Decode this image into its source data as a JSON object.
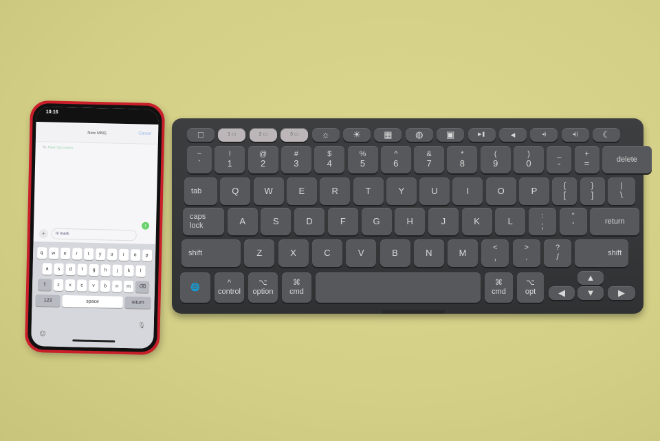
{
  "phone": {
    "status_time": "10:16",
    "nav_title": "New MMS",
    "cancel": "Cancel",
    "to_label": "To:",
    "to_name": "Mark Spoonauer",
    "message": "hi mark",
    "plus_icon": "+",
    "send_icon": "arrow-up",
    "keyboard": {
      "row1": [
        "q",
        "w",
        "e",
        "r",
        "t",
        "y",
        "u",
        "i",
        "o",
        "p"
      ],
      "row2": [
        "a",
        "s",
        "d",
        "f",
        "g",
        "h",
        "j",
        "k",
        "l"
      ],
      "row3": [
        "z",
        "x",
        "c",
        "v",
        "b",
        "n",
        "m"
      ],
      "numbers": "123",
      "space": "space",
      "return": "return"
    }
  },
  "keyboard": {
    "fn_row": [
      "□",
      "1 ▭",
      "2 ▭",
      "3 ▭",
      "☼",
      "☀",
      "▦",
      "◍",
      "▣",
      "▶❚",
      "◂",
      "◂)",
      "◂))",
      "☾"
    ],
    "num_row": [
      [
        "~",
        "`"
      ],
      [
        "!",
        "1"
      ],
      [
        "@",
        "2"
      ],
      [
        "#",
        "3"
      ],
      [
        "$",
        "4"
      ],
      [
        "%",
        "5"
      ],
      [
        "^",
        "6"
      ],
      [
        "&",
        "7"
      ],
      [
        "*",
        "8"
      ],
      [
        "(",
        "9"
      ],
      [
        ")",
        "0"
      ],
      [
        "_",
        "-"
      ],
      [
        "+",
        "="
      ],
      [
        "",
        "delete"
      ]
    ],
    "q_row": [
      [
        "",
        "tab"
      ],
      [
        "",
        "Q"
      ],
      [
        "",
        "W"
      ],
      [
        "",
        "E"
      ],
      [
        "",
        "R"
      ],
      [
        "",
        "T"
      ],
      [
        "",
        "Y"
      ],
      [
        "",
        "U"
      ],
      [
        "",
        "I"
      ],
      [
        "",
        "O"
      ],
      [
        "",
        "P"
      ],
      [
        "{",
        "["
      ],
      [
        "}",
        "]"
      ],
      [
        "|",
        "\\"
      ]
    ],
    "a_row": [
      [
        "caps",
        "lock"
      ],
      [
        "",
        "A"
      ],
      [
        "",
        "S"
      ],
      [
        "",
        "D"
      ],
      [
        "",
        "F"
      ],
      [
        "",
        "G"
      ],
      [
        "",
        "H"
      ],
      [
        "",
        "J"
      ],
      [
        "",
        "K"
      ],
      [
        "",
        "L"
      ],
      [
        ":",
        ";"
      ],
      [
        "\"",
        "'"
      ],
      [
        "",
        "return"
      ]
    ],
    "z_row": [
      [
        "",
        "shift"
      ],
      [
        "",
        "Z"
      ],
      [
        "",
        "X"
      ],
      [
        "",
        "C"
      ],
      [
        "",
        "V"
      ],
      [
        "",
        "B"
      ],
      [
        "",
        "N"
      ],
      [
        "",
        "M"
      ],
      [
        "<",
        ","
      ],
      [
        ">",
        "."
      ],
      [
        "?",
        "/"
      ],
      [
        "",
        "shift"
      ]
    ],
    "bottom_row": [
      [
        "",
        "🌐"
      ],
      [
        "^",
        "control"
      ],
      [
        "⌥",
        "option"
      ],
      [
        "⌘",
        "cmd"
      ],
      [
        "",
        ""
      ],
      [
        "⌘",
        "cmd"
      ],
      [
        "⌥",
        "opt"
      ]
    ],
    "arrows": [
      "▲",
      "◀",
      "▼",
      "▶"
    ]
  }
}
